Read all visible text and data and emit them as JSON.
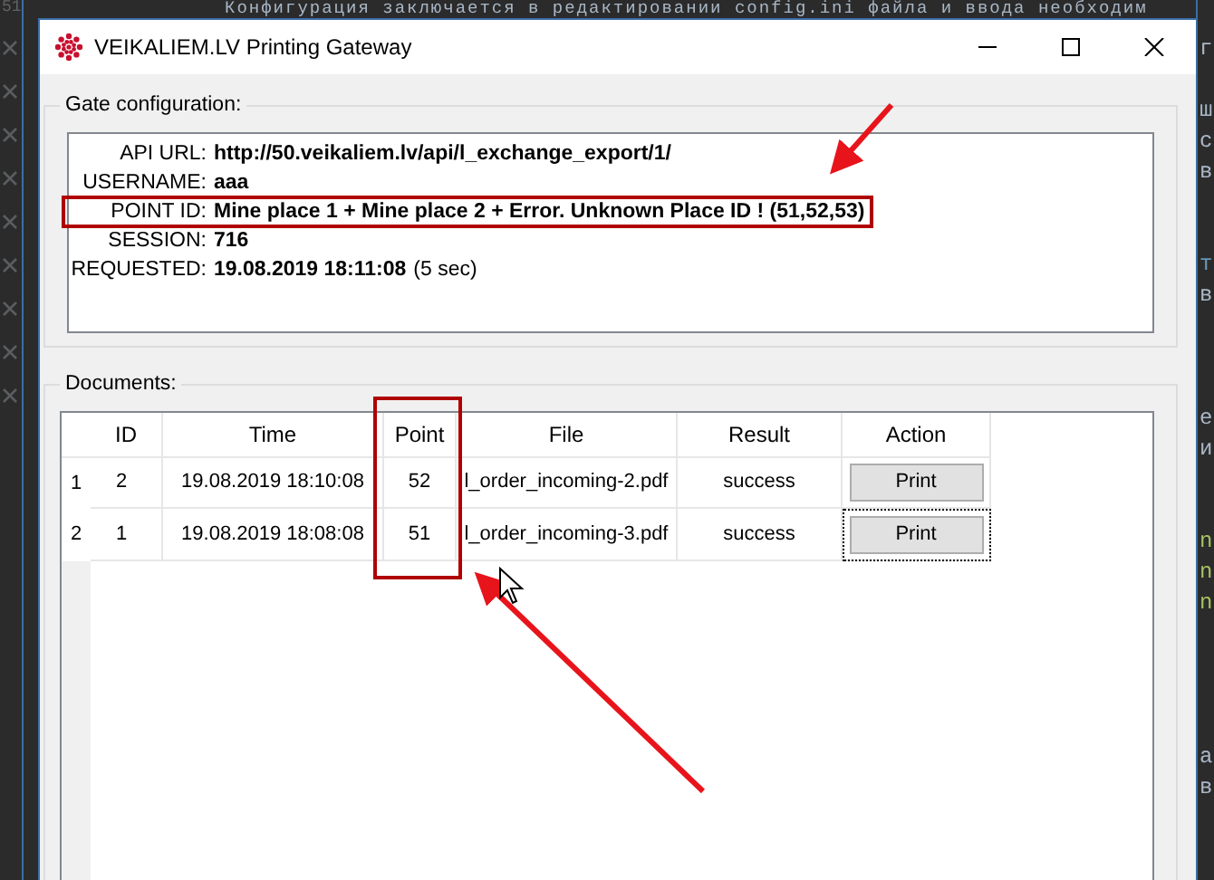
{
  "editor": {
    "top_line": "Конфигурация заключается в редактировании config.ini файла и ввода необходим",
    "gutter_number": "51",
    "right_fragments": [
      {
        "text": "г",
        "color": "#a9b7c6"
      },
      {
        "text": "ш",
        "color": "#a9b7c6"
      },
      {
        "text": "с",
        "color": "#a9b7c6"
      },
      {
        "text": "в",
        "color": "#a9b7c6"
      },
      {
        "text": "т",
        "color": "#6897bb"
      },
      {
        "text": "в",
        "color": "#a9b7c6"
      },
      {
        "text": "е",
        "color": "#a9b7c6"
      },
      {
        "text": "и",
        "color": "#a9b7c6"
      },
      {
        "text": "n",
        "color": "#a5c261"
      },
      {
        "text": "n",
        "color": "#a5c261"
      },
      {
        "text": "n",
        "color": "#a5c261"
      },
      {
        "text": "а",
        "color": "#a9b7c6"
      },
      {
        "text": "в",
        "color": "#a9b7c6"
      }
    ]
  },
  "window": {
    "title": "VEIKALIEM.LV Printing Gateway"
  },
  "gate_configuration": {
    "title": "Gate configuration:",
    "fields": [
      {
        "label": "API URL:",
        "value": "http://50.veikaliem.lv/api/l_exchange_export/1/"
      },
      {
        "label": "USERNAME:",
        "value": "aaa"
      },
      {
        "label": "POINT ID:",
        "value": "Mine place 1 + Mine place 2 + Error. Unknown Place ID ! (51,52,53)"
      },
      {
        "label": "SESSION:",
        "value": "716"
      },
      {
        "label": "REQUESTED:",
        "value": "19.08.2019 18:11:08",
        "note": "(5 sec)"
      }
    ]
  },
  "documents": {
    "title": "Documents:",
    "columns": [
      "ID",
      "Time",
      "Point",
      "File",
      "Result",
      "Action"
    ],
    "rows": [
      {
        "number": "1",
        "cells": [
          "2",
          "19.08.2019 18:10:08",
          "52",
          "l_order_incoming-2.pdf",
          "success"
        ],
        "action": "Print",
        "focused": false
      },
      {
        "number": "2",
        "cells": [
          "1",
          "19.08.2019 18:08:08",
          "51",
          "l_order_incoming-3.pdf",
          "success"
        ],
        "action": "Print",
        "focused": true
      }
    ]
  }
}
